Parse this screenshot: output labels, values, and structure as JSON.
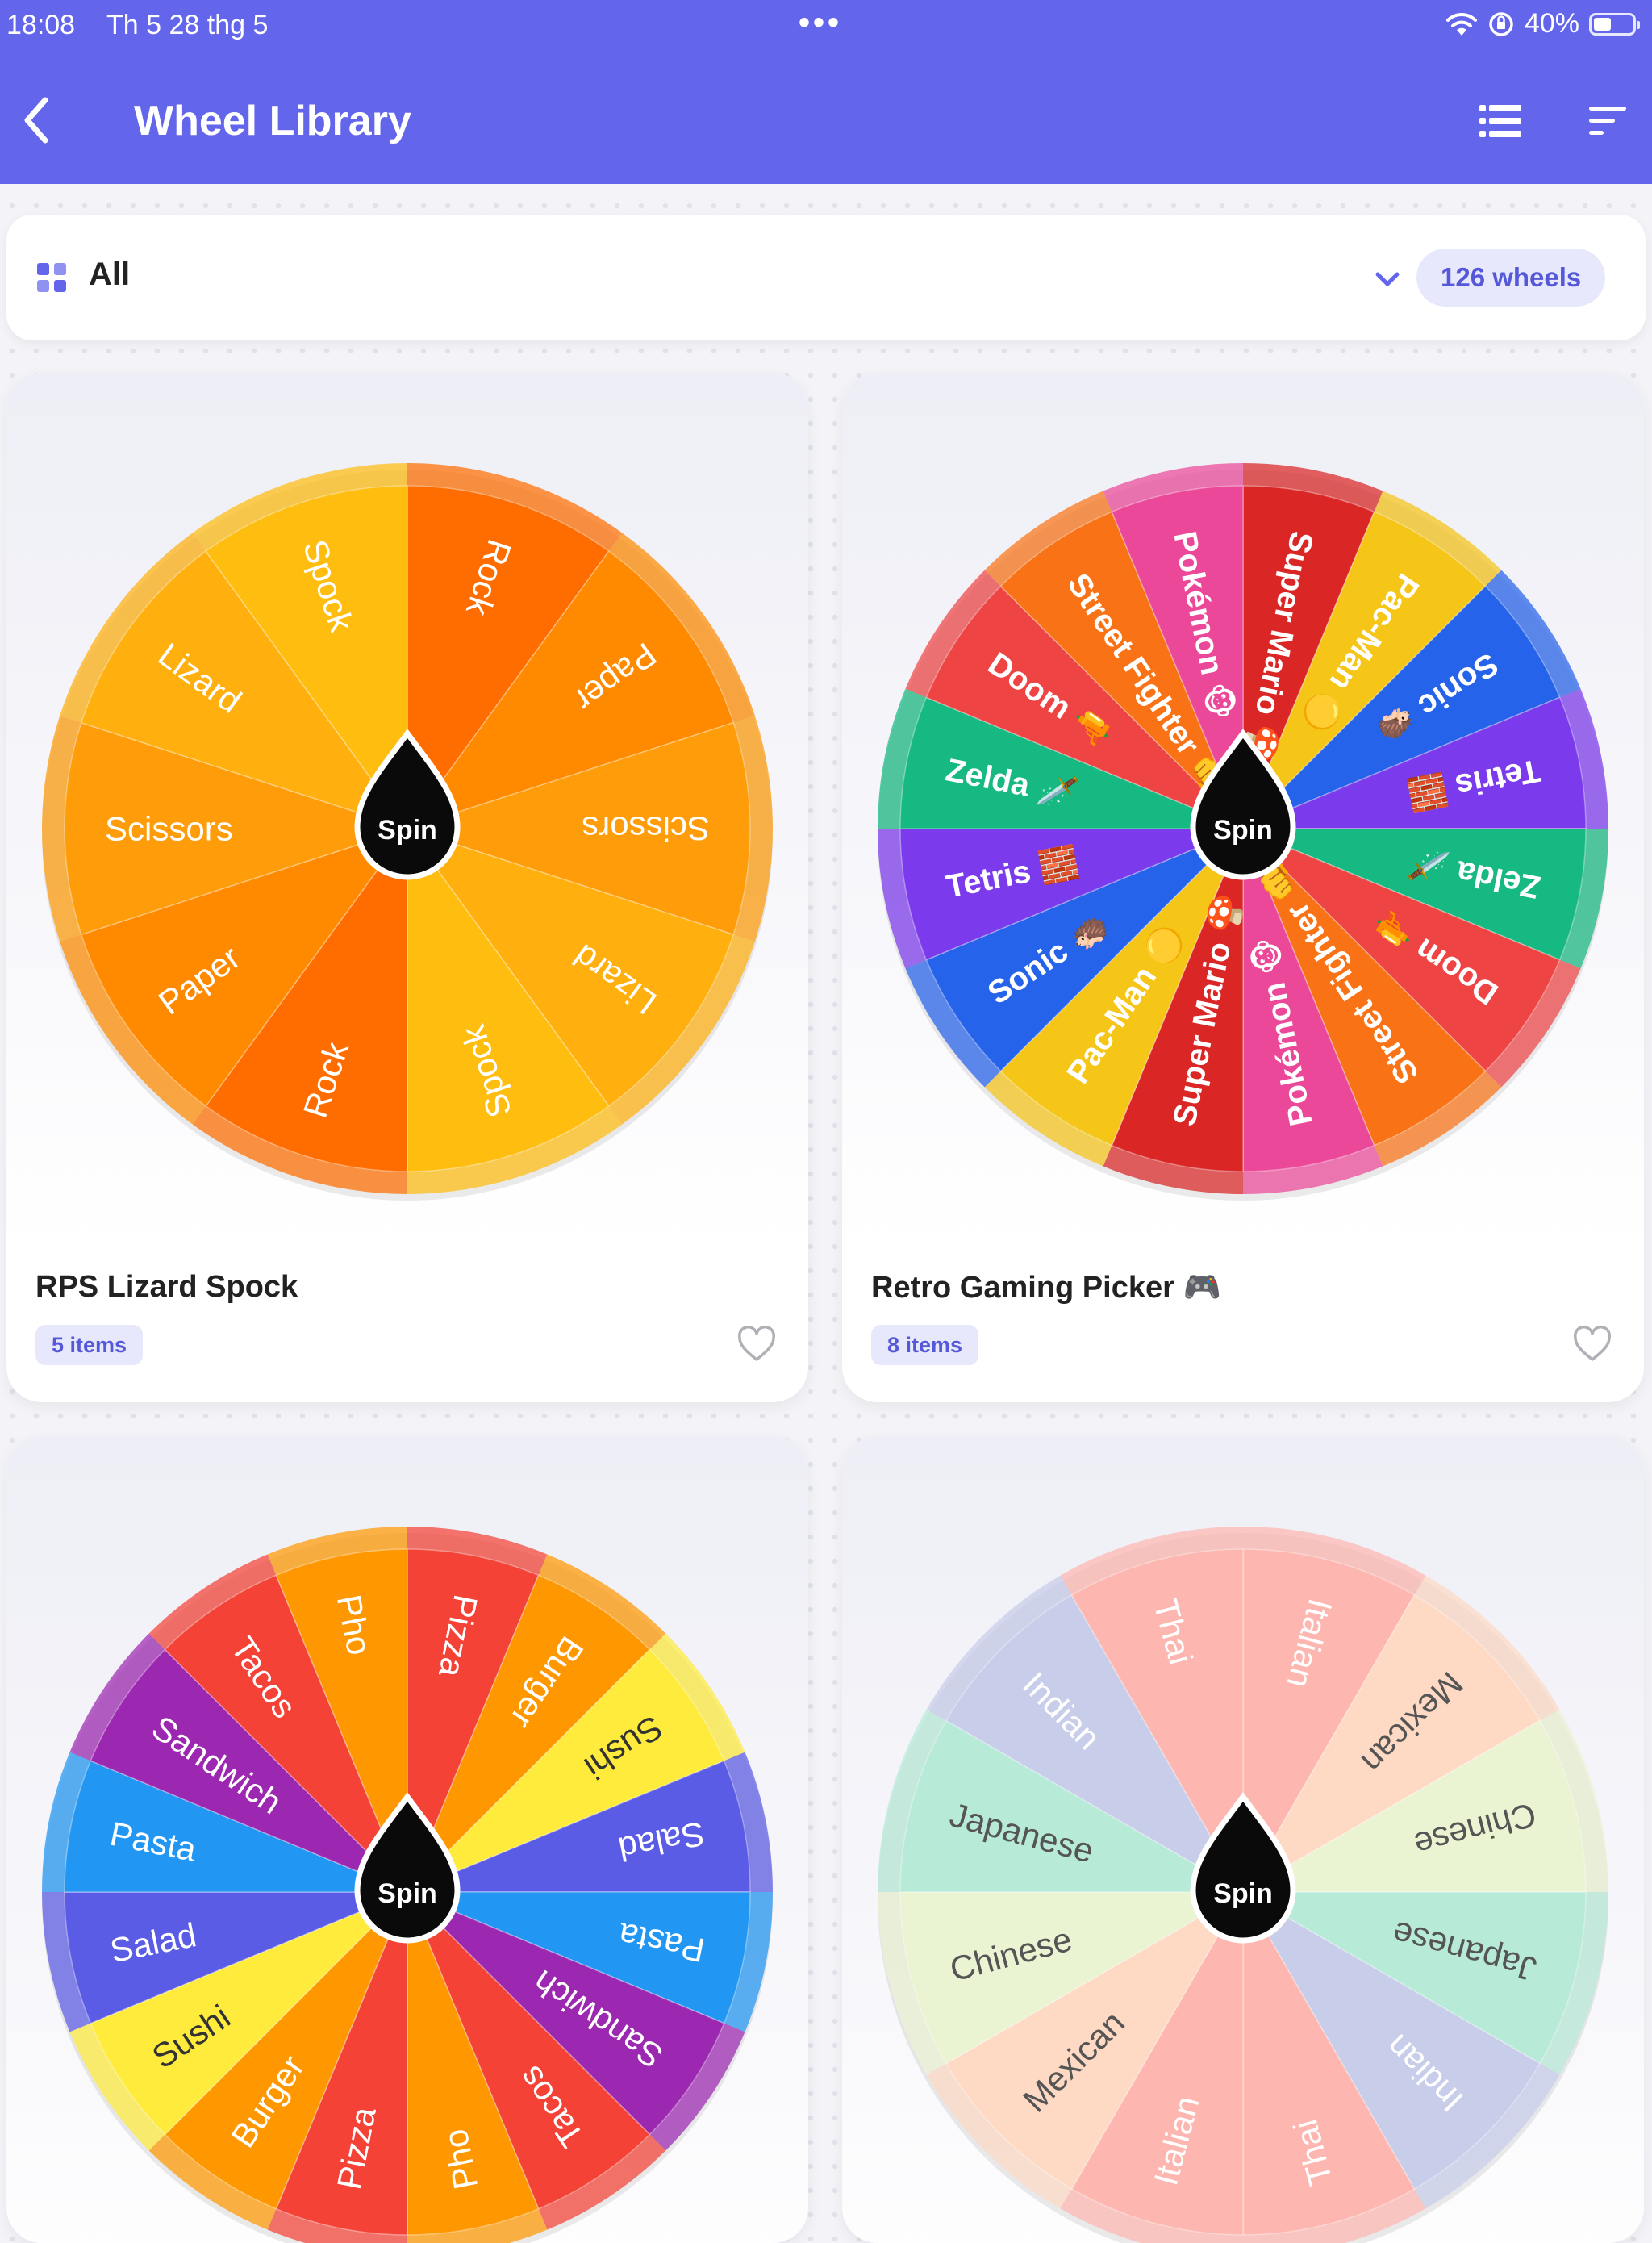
{
  "status_bar": {
    "time": "18:08",
    "date": "Th 5 28 thg 5",
    "battery": "40%",
    "battery_level": 0.4
  },
  "header": {
    "title": "Wheel Library",
    "icons": [
      "chevron-left-icon",
      "list-icon",
      "sort-icon"
    ]
  },
  "filter": {
    "label": "All",
    "count": "126 wheels"
  },
  "spin_label": "Spin",
  "wheels": [
    {
      "title": "RPS Lizard Spock",
      "items_label": "5 items",
      "font_weight": "400",
      "text_color": "#ffffff",
      "segments": [
        {
          "label": "Rock",
          "color": "#ff6d00"
        },
        {
          "label": "Paper",
          "color": "#ff8a00"
        },
        {
          "label": "Scissors",
          "color": "#ff9c0a"
        },
        {
          "label": "Lizard",
          "color": "#ffb00f"
        },
        {
          "label": "Spock",
          "color": "#ffbd10"
        },
        {
          "label": "Rock",
          "color": "#ff6d00"
        },
        {
          "label": "Paper",
          "color": "#ff8a00"
        },
        {
          "label": "Scissors",
          "color": "#ff9c0a"
        },
        {
          "label": "Lizard",
          "color": "#ffb00f"
        },
        {
          "label": "Spock",
          "color": "#ffbd10"
        }
      ]
    },
    {
      "title": "Retro Gaming Picker 🎮",
      "items_label": "8 items",
      "font_weight": "700",
      "text_color": "#ffffff",
      "segments": [
        {
          "label": "Super Mario 🍄",
          "color": "#db2626"
        },
        {
          "label": "Pac-Man 🟡",
          "color": "#f5c518"
        },
        {
          "label": "Sonic 🦔",
          "color": "#2563eb"
        },
        {
          "label": "Tetris 🧱",
          "color": "#7c3aed"
        },
        {
          "label": "Zelda 🗡️",
          "color": "#16b981"
        },
        {
          "label": "Doom 🔫",
          "color": "#ef4444"
        },
        {
          "label": "Street Fighter 👊",
          "color": "#f97316"
        },
        {
          "label": "Pokémon 🐵",
          "color": "#ec4899"
        },
        {
          "label": "Super Mario 🍄",
          "color": "#db2626"
        },
        {
          "label": "Pac-Man 🟡",
          "color": "#f5c518"
        },
        {
          "label": "Sonic 🦔",
          "color": "#2563eb"
        },
        {
          "label": "Tetris 🧱",
          "color": "#7c3aed"
        },
        {
          "label": "Zelda 🗡️",
          "color": "#16b981"
        },
        {
          "label": "Doom 🔫",
          "color": "#ef4444"
        },
        {
          "label": "Street Fighter 👊",
          "color": "#f97316"
        },
        {
          "label": "Pokémon 🐵",
          "color": "#ec4899"
        }
      ]
    },
    {
      "title": "",
      "items_label": "",
      "font_weight": "400",
      "text_color": "#ffffff",
      "segments": [
        {
          "label": "Pizza",
          "color": "#f44336"
        },
        {
          "label": "Burger",
          "color": "#ff9800"
        },
        {
          "label": "Sushi",
          "color": "#ffeb3b",
          "text": "#333333"
        },
        {
          "label": "Salad",
          "color": "#5b5ce6"
        },
        {
          "label": "Pasta",
          "color": "#2196f3"
        },
        {
          "label": "Sandwich",
          "color": "#9c27b0"
        },
        {
          "label": "Tacos",
          "color": "#f44336"
        },
        {
          "label": "Pho",
          "color": "#ff9800"
        },
        {
          "label": "Pizza",
          "color": "#f44336"
        },
        {
          "label": "Burger",
          "color": "#ff9800"
        },
        {
          "label": "Sushi",
          "color": "#ffeb3b",
          "text": "#333333"
        },
        {
          "label": "Salad",
          "color": "#5b5ce6"
        },
        {
          "label": "Pasta",
          "color": "#2196f3"
        },
        {
          "label": "Sandwich",
          "color": "#9c27b0"
        },
        {
          "label": "Tacos",
          "color": "#f44336"
        },
        {
          "label": "Pho",
          "color": "#ff9800"
        }
      ]
    },
    {
      "title": "",
      "items_label": "",
      "font_weight": "400",
      "text_color": "#555555",
      "segments": [
        {
          "label": "Italian",
          "color": "#fdb7b0",
          "text": "#ffffff"
        },
        {
          "label": "Mexican",
          "color": "#fed9c3"
        },
        {
          "label": "Chinese",
          "color": "#eaf3d2"
        },
        {
          "label": "Japanese",
          "color": "#b8ead8"
        },
        {
          "label": "Indian",
          "color": "#c8cdea",
          "text": "#ffffff"
        },
        {
          "label": "Thai",
          "color": "#fdb7b0",
          "text": "#ffffff"
        },
        {
          "label": "Italian",
          "color": "#fdb7b0",
          "text": "#ffffff"
        },
        {
          "label": "Mexican",
          "color": "#fed9c3"
        },
        {
          "label": "Chinese",
          "color": "#eaf3d2"
        },
        {
          "label": "Japanese",
          "color": "#b8ead8"
        },
        {
          "label": "Indian",
          "color": "#c8cdea",
          "text": "#ffffff"
        },
        {
          "label": "Thai",
          "color": "#fdb7b0",
          "text": "#ffffff"
        }
      ]
    }
  ]
}
